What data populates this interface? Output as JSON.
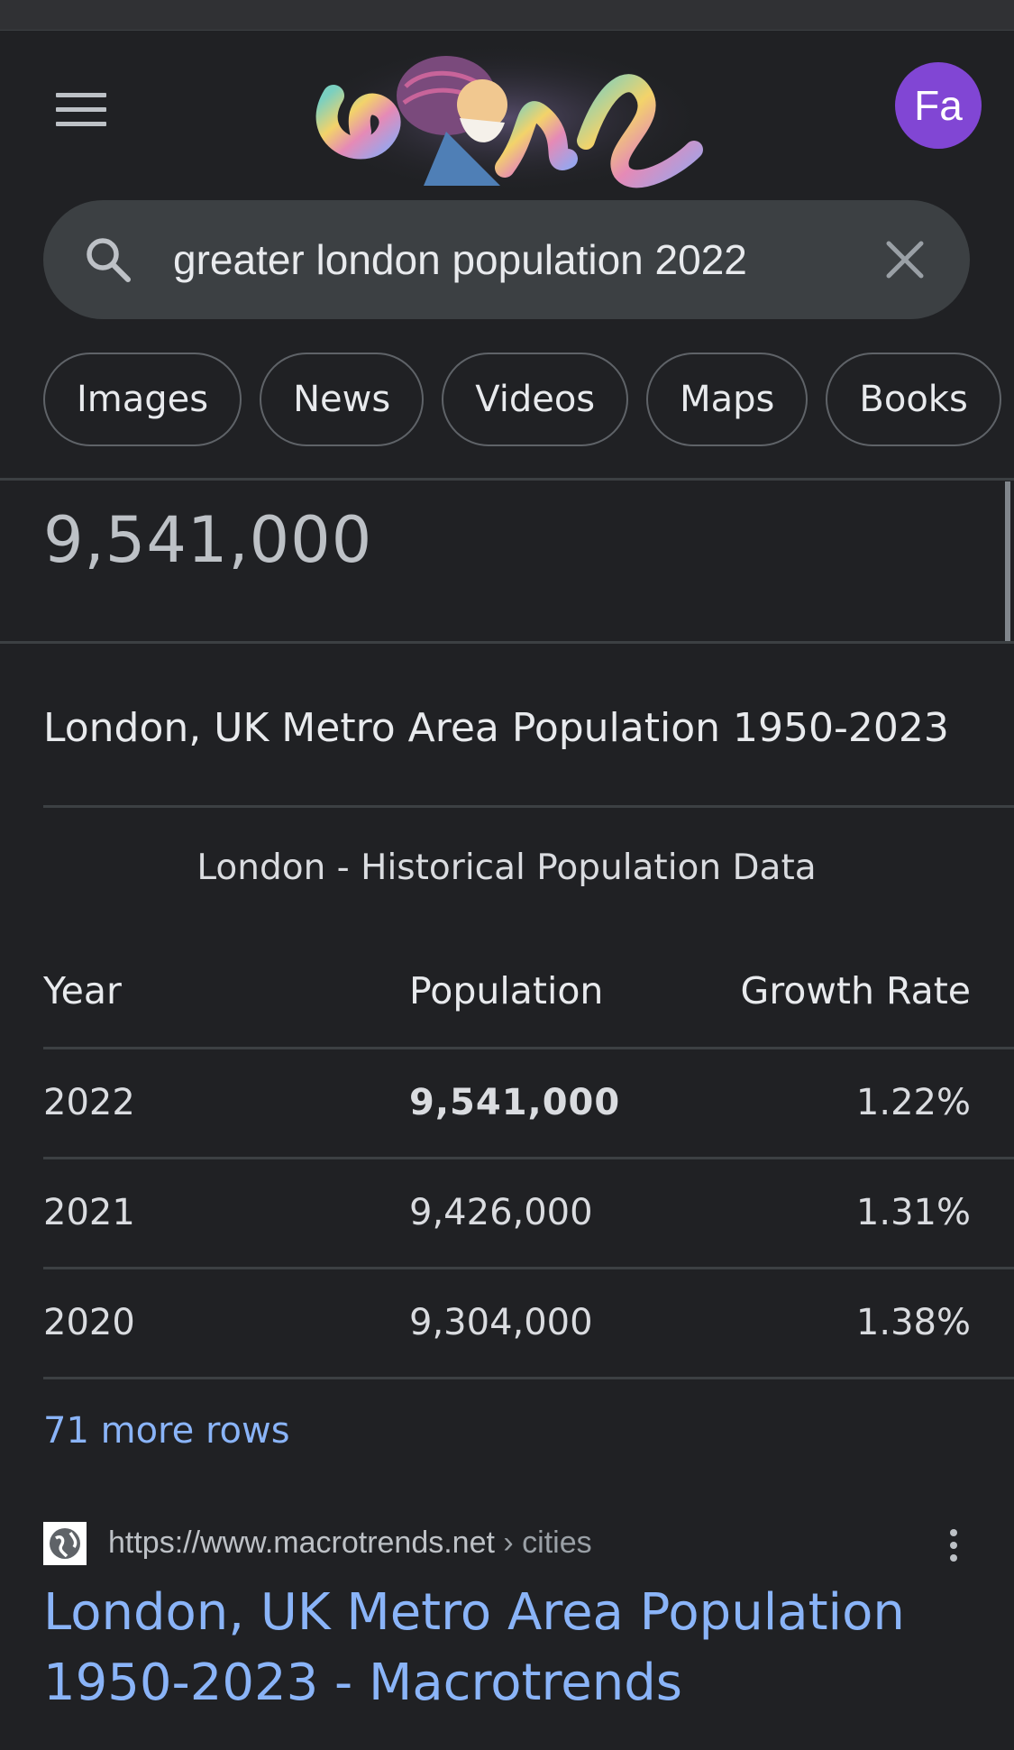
{
  "header": {
    "avatar_initials": "Fa",
    "doodle_name": "google-doodle",
    "search": {
      "value": "greater london population 2022",
      "placeholder": ""
    },
    "chips": [
      "Images",
      "News",
      "Videos",
      "Maps",
      "Books"
    ]
  },
  "answer": {
    "number": "9,541,000"
  },
  "featured": {
    "title": "London, UK Metro Area Population 1950-2023",
    "table_caption": "London - Historical Population Data",
    "columns": [
      "Year",
      "Population",
      "Growth Rate"
    ],
    "rows": [
      {
        "year": "2022",
        "population": "9,541,000",
        "growth": "1.22%"
      },
      {
        "year": "2021",
        "population": "9,426,000",
        "growth": "1.31%"
      },
      {
        "year": "2020",
        "population": "9,304,000",
        "growth": "1.38%"
      }
    ],
    "more_rows": "71 more rows"
  },
  "result": {
    "url": "https://www.macrotrends.net",
    "breadcrumb": " › cities",
    "title": "London, UK Metro Area Population 1950-2023 - Macrotrends"
  },
  "colors": {
    "background": "#202124",
    "link": "#8ab4f8",
    "avatar": "#8146d4",
    "searchbox": "#3c4043"
  }
}
